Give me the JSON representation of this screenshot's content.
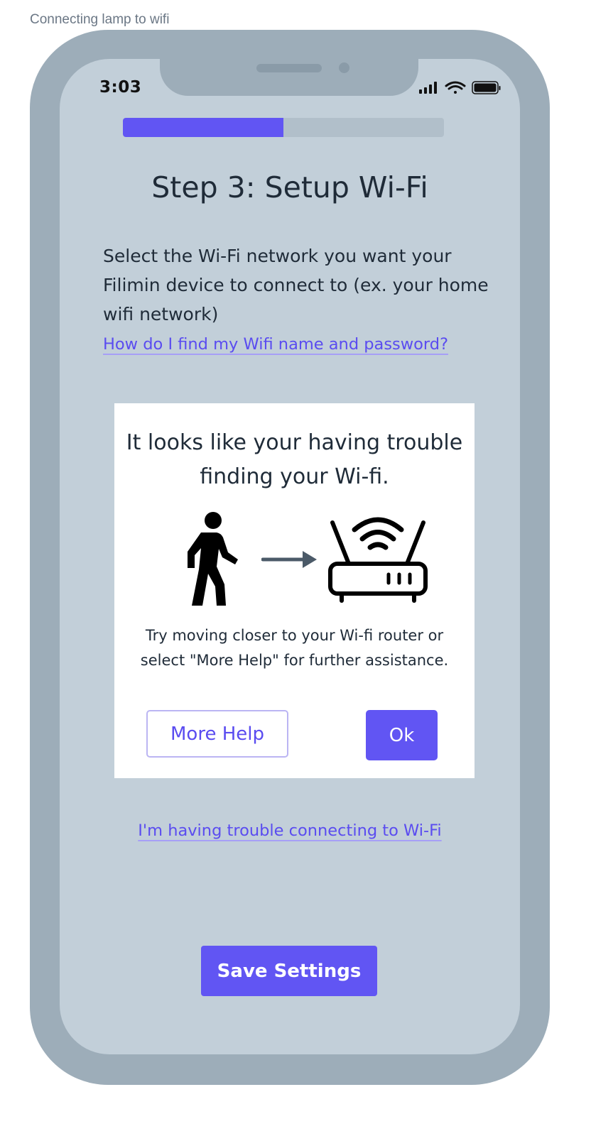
{
  "frame_label": "Connecting lamp to wifi",
  "status_bar": {
    "time": "3:03",
    "icons": [
      "signal-icon",
      "wifi-icon",
      "battery-icon"
    ]
  },
  "progress": {
    "fraction": 0.5
  },
  "step_title": "Step 3: Setup Wi-Fi",
  "instructions": "Select the Wi-Fi network you want your Filimin device to connect to (ex. your home wifi network)",
  "help_link": "How do I find my Wifi name and password?",
  "modal": {
    "title": "It looks like your having trouble finding your Wi-fi.",
    "icons": [
      "walking-person-icon",
      "arrow-right-icon",
      "wifi-router-icon"
    ],
    "message": "Try moving closer to your Wi-fi router or select \"More Help\" for further assistance.",
    "more_help_label": "More Help",
    "ok_label": "Ok"
  },
  "trouble_link": "I'm having trouble connecting to Wi-Fi",
  "save_label": "Save Settings",
  "colors": {
    "accent": "#6155f3",
    "link": "#5a4cf0",
    "screen_bg": "#c2cfd9",
    "phone_body": "#9dadb9",
    "text": "#1f2b38"
  }
}
